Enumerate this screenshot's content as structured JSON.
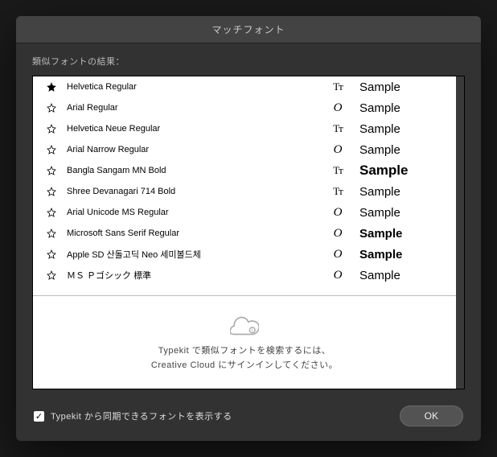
{
  "window": {
    "title": "マッチフォント"
  },
  "section_label": "類似フォントの結果：",
  "fonts": [
    {
      "favorite": true,
      "name": "Helvetica Regular",
      "type": "tt",
      "sample": "Sample"
    },
    {
      "favorite": false,
      "name": "Arial Regular",
      "type": "o",
      "sample": "Sample"
    },
    {
      "favorite": false,
      "name": "Helvetica Neue Regular",
      "type": "tt",
      "sample": "Sample"
    },
    {
      "favorite": false,
      "name": "Arial Narrow Regular",
      "type": "o",
      "sample": "Sample"
    },
    {
      "favorite": false,
      "name": "Bangla Sangam MN Bold",
      "type": "tt",
      "sample": "Sample"
    },
    {
      "favorite": false,
      "name": "Shree Devanagari 714 Bold",
      "type": "tt",
      "sample": "Sample"
    },
    {
      "favorite": false,
      "name": "Arial Unicode MS Regular",
      "type": "o",
      "sample": "Sample"
    },
    {
      "favorite": false,
      "name": "Microsoft Sans Serif Regular",
      "type": "o",
      "sample": "Sample"
    },
    {
      "favorite": false,
      "name": "Apple SD 산돌고딕 Neo 세미볼드체",
      "type": "o",
      "sample": "Sample"
    },
    {
      "favorite": false,
      "name": "ＭＳ Ｐゴシック 標準",
      "type": "o",
      "sample": "Sample"
    }
  ],
  "typekit_message": {
    "line1": "Typekit で類似フォントを検索するには、",
    "line2": "Creative Cloud にサインインしてください。"
  },
  "footer": {
    "checkbox_label": "Typekit から同期できるフォントを表示する",
    "checkbox_checked": true,
    "ok_label": "OK"
  },
  "icons": {
    "type_tt": "Tᴛ",
    "type_o": "O"
  }
}
